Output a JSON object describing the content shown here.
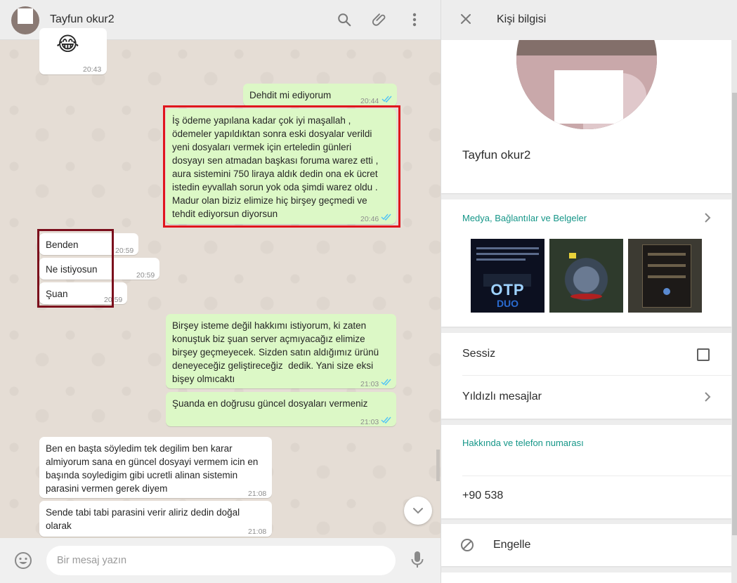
{
  "chat": {
    "contact_name": "Tayfun okur2",
    "composer_placeholder": "Bir mesaj yazın",
    "messages": [
      {
        "dir": "in",
        "emoji": "😂",
        "text": "",
        "time": "20:43"
      },
      {
        "dir": "out",
        "text": "Dehdit mi ediyorum",
        "time": "20:44",
        "read": true
      },
      {
        "dir": "out",
        "text": "İş ödeme yapılana kadar çok iyi maşallah ,\nödemeler yapıldıktan sonra eski dosyalar verildi\nyeni dosyaları vermek için erteledin günleri\ndosyayı sen atmadan başkası foruma warez etti ,\naura sistemini 750 liraya aldık dedin ona ek ücret\nistedin eyvallah sorun yok oda şimdi warez oldu .\nMadur olan biziz elimize hiç birşey geçmedi ve\ntehdit ediyorsun diyorsun",
        "time": "20:46",
        "read": true
      },
      {
        "dir": "in",
        "text": "Benden",
        "time": "20:59"
      },
      {
        "dir": "in",
        "text": "Ne istiyosun",
        "time": "20:59"
      },
      {
        "dir": "in",
        "text": "Şuan",
        "time": "20:59"
      },
      {
        "dir": "out",
        "text": "Birşey isteme değil hakkımı istiyorum, ki zaten\nkonuştuk biz şuan server açmıyacağız elimize\nbirşey geçmeyecek. Sizden satın aldığımız ürünü\ndeneyeceğiz geliştireceğiz  dedik. Yani size eksi\nbişey olmıcaktı",
        "time": "21:03",
        "read": true
      },
      {
        "dir": "out",
        "text": "Şuanda en doğrusu güncel dosyaları vermeniz",
        "time": "21:03",
        "read": true
      },
      {
        "dir": "in",
        "text": "Ben en başta söyledim tek degilim ben karar\nalmiyorum sana en güncel dosyayi vermem icin en\nbaşında soyledigim gibi ucretli alinan sistemin\nparasini vermen gerek diyem",
        "time": "21:08"
      },
      {
        "dir": "in",
        "text": "Sende tabi tabi parasini verir aliriz dedin doğal\nolarak",
        "time": "21:08"
      }
    ]
  },
  "info": {
    "title": "Kişi bilgisi",
    "name": "Tayfun okur2",
    "media_title": "Medya, Bağlantılar ve Belgeler",
    "mute_label": "Sessiz",
    "starred_label": "Yıldızlı mesajlar",
    "about_title": "Hakkında ve telefon numarası",
    "phone": "+90 538",
    "block_label": "Engelle",
    "thumb1": {
      "banner": "OTP",
      "sub": "DUO"
    }
  },
  "colors": {
    "accent": "#159688",
    "outgoing": "#dcf8c6",
    "incoming": "#ffffff",
    "read_tick": "#4fc3f7",
    "highlight_red": "#e0161d",
    "highlight_dark": "#7b0e1c"
  },
  "icons": [
    "search-icon",
    "attach-icon",
    "menu-icon",
    "close-icon",
    "chevron-right-icon",
    "chevron-down-icon",
    "emoji-icon",
    "mic-icon",
    "block-icon",
    "read-tick-icon"
  ]
}
